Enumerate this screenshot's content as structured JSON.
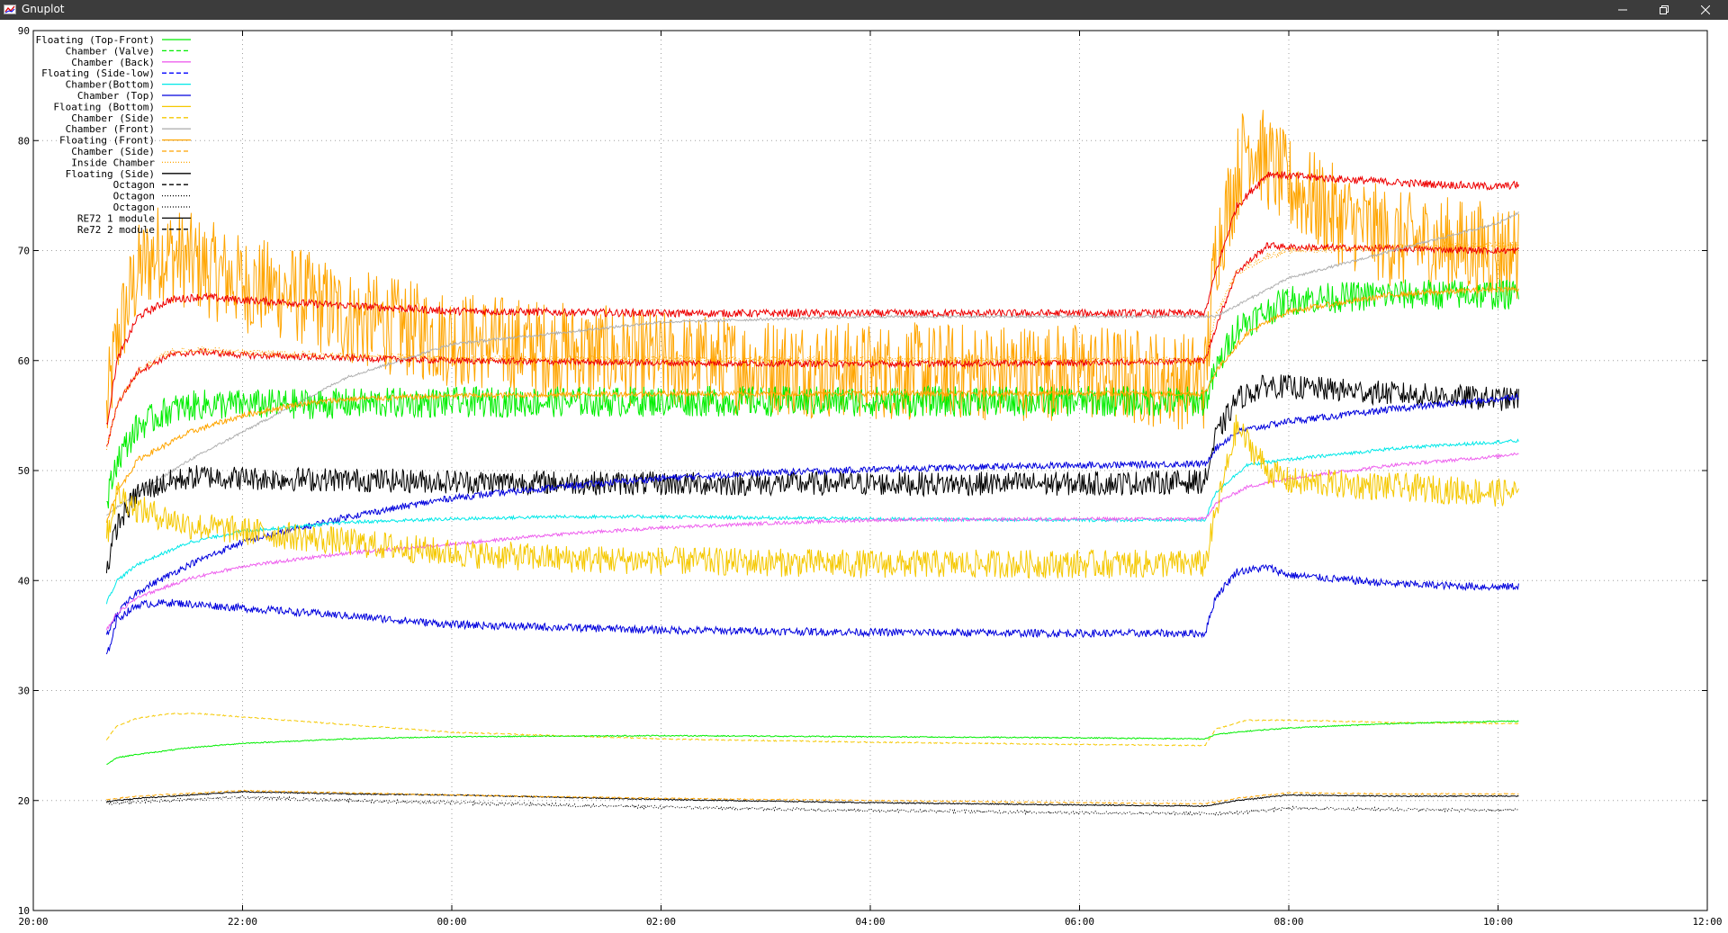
{
  "window": {
    "title": "Gnuplot",
    "icons": {
      "app": "gnuplot-app-icon",
      "minimize": "minimize-icon",
      "restore": "restore-icon",
      "close": "close-icon"
    },
    "titlebar_color": "#3c3c3c"
  },
  "chart_data": {
    "type": "line",
    "title": "",
    "xlabel": "",
    "ylabel": "",
    "grid": true,
    "legend_position": "top-left",
    "xlim": [
      0,
      16
    ],
    "ylim": [
      10,
      90
    ],
    "xticks": [
      {
        "v": 0,
        "label": "20:00"
      },
      {
        "v": 2,
        "label": "22:00"
      },
      {
        "v": 4,
        "label": "00:00"
      },
      {
        "v": 6,
        "label": "02:00"
      },
      {
        "v": 8,
        "label": "04:00"
      },
      {
        "v": 10,
        "label": "06:00"
      },
      {
        "v": 12,
        "label": "08:00"
      },
      {
        "v": 14,
        "label": "10:00"
      },
      {
        "v": 16,
        "label": "12:00"
      }
    ],
    "yticks": [
      10,
      20,
      30,
      40,
      50,
      60,
      70,
      80,
      90
    ],
    "legend": [
      {
        "label": "Floating (Top-Front)",
        "color": "#00ee00",
        "dash": "solid"
      },
      {
        "label": "Chamber (Valve)",
        "color": "#00ee00",
        "dash": "dashed"
      },
      {
        "label": "Chamber (Back)",
        "color": "#ee60ee",
        "dash": "solid"
      },
      {
        "label": "Floating (Side-low)",
        "color": "#0000ff",
        "dash": "dashed"
      },
      {
        "label": "Chamber(Bottom)",
        "color": "#00e8e8",
        "dash": "solid"
      },
      {
        "label": "Chamber (Top)",
        "color": "#0000dd",
        "dash": "solid"
      },
      {
        "label": "Floating (Bottom)",
        "color": "#f5c800",
        "dash": "solid"
      },
      {
        "label": "Chamber (Side)",
        "color": "#f5c800",
        "dash": "dashed"
      },
      {
        "label": "Chamber (Front)",
        "color": "#b0b0b0",
        "dash": "solid"
      },
      {
        "label": "Floating (Front)",
        "color": "#ffa500",
        "dash": "solid"
      },
      {
        "label": "Chamber (Side)",
        "color": "#ffa500",
        "dash": "dashed"
      },
      {
        "label": "Inside Chamber",
        "color": "#ffa500",
        "dash": "dotted"
      },
      {
        "label": "Floating (Side)",
        "color": "#000000",
        "dash": "solid"
      },
      {
        "label": "Octagon",
        "color": "#000000",
        "dash": "dashed"
      },
      {
        "label": "Octagon",
        "color": "#000000",
        "dash": "dotted"
      },
      {
        "label": "Octagon",
        "color": "#000000",
        "dash": "dotted"
      },
      {
        "label": "RE72 1 module",
        "color": "#000000",
        "dash": "solid"
      },
      {
        "label": "Re72 2 module",
        "color": "#000000",
        "dash": "dashed"
      }
    ],
    "series": [
      {
        "color": "#ffa500",
        "dash": "solid",
        "noise": 4.5,
        "x": [
          0.7,
          0.8,
          1.0,
          1.2,
          1.5,
          2.0,
          2.5,
          3.0,
          4.0,
          5.0,
          6.0,
          8.0,
          10.0,
          11.2,
          11.3,
          11.6,
          11.8,
          12.0,
          12.5,
          13.0,
          14.0,
          14.2
        ],
        "y": [
          55,
          62,
          68,
          70,
          69,
          67,
          66,
          64,
          62,
          61,
          60,
          59,
          59,
          58,
          70,
          80,
          78,
          76,
          73,
          71,
          70,
          70
        ]
      },
      {
        "color": "#ee0000",
        "dash": "solid",
        "noise": 0.35,
        "x": [
          0.7,
          0.8,
          1.0,
          1.3,
          1.6,
          2.0,
          3.0,
          4.0,
          6.0,
          8.0,
          10.0,
          11.2,
          11.3,
          11.5,
          11.8,
          12.0,
          13.0,
          14.0,
          14.2
        ],
        "y": [
          54,
          60,
          64,
          65.5,
          65.8,
          65.5,
          65,
          64.5,
          64.3,
          64.3,
          64.3,
          64.3,
          68,
          74,
          77,
          76.8,
          76.2,
          75.8,
          76
        ]
      },
      {
        "color": "#ee0000",
        "dash": "solid",
        "noise": 0.3,
        "x": [
          0.7,
          0.8,
          1.0,
          1.3,
          1.6,
          2.0,
          4.0,
          6.0,
          8.0,
          10.0,
          11.2,
          11.3,
          11.5,
          11.8,
          12.0,
          13.0,
          14.0,
          14.2
        ],
        "y": [
          52,
          56,
          59,
          60.5,
          60.8,
          60.5,
          60,
          59.8,
          59.7,
          59.8,
          60,
          63,
          68,
          70.5,
          70.3,
          70.2,
          70,
          70
        ]
      },
      {
        "color": "#ffa500",
        "dash": "dotted",
        "noise": 0.3,
        "x": [
          0.7,
          0.8,
          1.0,
          1.3,
          1.6,
          2.0,
          4.0,
          11.2,
          11.3,
          11.5,
          11.8,
          12.0,
          13.0,
          14.0,
          14.2
        ],
        "y": [
          52,
          56,
          59,
          60.8,
          61,
          60.7,
          60.2,
          60,
          64,
          68,
          69.5,
          70,
          70.3,
          70.5,
          70.5
        ]
      },
      {
        "color": "#b0b0b0",
        "dash": "solid",
        "noise": 0.12,
        "x": [
          0.7,
          1.0,
          1.5,
          2.0,
          2.5,
          3.0,
          4.0,
          6.0,
          8.0,
          10.0,
          11.2,
          11.3,
          11.6,
          12.0,
          13.0,
          14.0,
          14.2
        ],
        "y": [
          46,
          48,
          51,
          53.5,
          56,
          58.5,
          61.5,
          63.5,
          64,
          64,
          64,
          64,
          65.5,
          67.5,
          70,
          72.5,
          73.5
        ]
      },
      {
        "color": "#00ee00",
        "dash": "solid",
        "noise": 1.4,
        "x": [
          0.7,
          0.8,
          1.0,
          1.3,
          1.6,
          2.0,
          4.0,
          6.0,
          8.0,
          10.0,
          11.2,
          11.3,
          11.5,
          12.0,
          13.0,
          14.0,
          14.2
        ],
        "y": [
          47,
          51,
          54,
          55.5,
          56,
          56,
          56.2,
          56.3,
          56.3,
          56.3,
          56.3,
          59,
          63,
          65.5,
          66,
          66,
          66
        ]
      },
      {
        "color": "#ffa500",
        "dash": "solid",
        "noise": 0.25,
        "x": [
          0.7,
          0.8,
          1.0,
          1.5,
          2.0,
          2.5,
          3.0,
          4.0,
          6.0,
          8.0,
          10.0,
          11.2,
          11.3,
          11.6,
          12.0,
          13.0,
          14.0,
          14.2
        ],
        "y": [
          45.5,
          48,
          51,
          53.5,
          55,
          56,
          56.5,
          56.8,
          57,
          57,
          57,
          57,
          59,
          62.5,
          64.5,
          66,
          66.5,
          66.5
        ]
      },
      {
        "color": "#000000",
        "dash": "solid",
        "noise": 1.1,
        "x": [
          0.7,
          0.8,
          1.0,
          1.3,
          1.6,
          2.0,
          4.0,
          6.0,
          8.0,
          10.0,
          11.2,
          11.3,
          11.5,
          11.8,
          12.0,
          13.0,
          14.0,
          14.2
        ],
        "y": [
          41,
          45,
          48,
          49,
          49.5,
          49.3,
          49,
          48.8,
          48.8,
          48.8,
          49,
          53,
          56.5,
          57.8,
          57.6,
          57,
          56.5,
          56.5
        ]
      },
      {
        "color": "#0000dd",
        "dash": "solid",
        "noise": 0.3,
        "x": [
          0.7,
          0.8,
          1.0,
          1.5,
          2.0,
          3.0,
          4.0,
          5.0,
          6.0,
          7.0,
          8.0,
          9.0,
          10.0,
          11.2,
          11.3,
          11.5,
          12.0,
          12.5,
          13.0,
          14.0,
          14.2
        ],
        "y": [
          35,
          37,
          39,
          41.5,
          43.5,
          45.8,
          47.5,
          48.5,
          49.3,
          49.8,
          50.1,
          50.3,
          50.5,
          50.6,
          52,
          53.5,
          54.5,
          55,
          55.6,
          56.5,
          56.8
        ]
      },
      {
        "color": "#00e8e8",
        "dash": "solid",
        "noise": 0.15,
        "x": [
          0.7,
          0.8,
          1.0,
          1.5,
          2.0,
          3.0,
          4.0,
          5.0,
          6.0,
          8.0,
          10.0,
          11.2,
          11.3,
          11.6,
          12.0,
          13.0,
          14.0,
          14.2
        ],
        "y": [
          38,
          40,
          41.5,
          43.5,
          44.5,
          45.3,
          45.6,
          45.8,
          45.8,
          45.6,
          45.5,
          45.5,
          48,
          50.5,
          51,
          52,
          52.6,
          52.7
        ]
      },
      {
        "color": "#ee60ee",
        "dash": "solid",
        "noise": 0.15,
        "x": [
          0.7,
          0.8,
          1.0,
          1.5,
          2.0,
          3.0,
          4.0,
          5.0,
          6.0,
          7.0,
          8.0,
          10.0,
          11.2,
          11.3,
          11.6,
          12.0,
          13.0,
          14.0,
          14.2
        ],
        "y": [
          35.5,
          37,
          38.5,
          40.2,
          41.3,
          42.5,
          43.3,
          44.2,
          44.8,
          45.2,
          45.5,
          45.6,
          45.6,
          47,
          48.5,
          49.3,
          50.5,
          51.3,
          51.6
        ]
      },
      {
        "color": "#f5c800",
        "dash": "solid",
        "noise": 1.3,
        "x": [
          0.7,
          0.8,
          1.0,
          1.5,
          2.0,
          3.0,
          4.0,
          5.0,
          6.0,
          8.0,
          10.0,
          11.2,
          11.3,
          11.5,
          11.8,
          12.0,
          13.0,
          14.0,
          14.2
        ],
        "y": [
          44,
          48,
          46.5,
          45,
          44.5,
          43.5,
          42.5,
          42,
          41.8,
          41.5,
          41.5,
          41.5,
          46,
          54,
          50,
          49,
          48.5,
          48,
          48
        ]
      },
      {
        "color": "#0000dd",
        "dash": "solid",
        "noise": 0.35,
        "x": [
          0.7,
          0.8,
          1.0,
          1.3,
          2.0,
          3.0,
          4.0,
          6.0,
          8.0,
          10.0,
          11.2,
          11.3,
          11.5,
          11.8,
          12.0,
          13.0,
          14.0,
          14.2
        ],
        "y": [
          33,
          36.5,
          37.8,
          38,
          37.5,
          36.8,
          36,
          35.5,
          35.3,
          35.2,
          35.2,
          38.5,
          40.8,
          41.2,
          40.5,
          39.7,
          39.4,
          39.5
        ]
      },
      {
        "color": "#f5c800",
        "dash": "dashed",
        "noise": 0.05,
        "x": [
          0.7,
          0.8,
          1.0,
          1.3,
          1.6,
          2.0,
          3.0,
          4.0,
          6.0,
          8.0,
          10.0,
          11.2,
          11.3,
          11.6,
          12.0,
          13.0,
          14.0,
          14.2
        ],
        "y": [
          25.5,
          26.8,
          27.5,
          27.9,
          27.9,
          27.6,
          26.9,
          26.2,
          25.6,
          25.3,
          25.1,
          25,
          26.5,
          27.3,
          27.3,
          27.1,
          27,
          27
        ]
      },
      {
        "color": "#00ee00",
        "dash": "solid",
        "noise": 0.05,
        "x": [
          0.7,
          0.8,
          1.0,
          1.5,
          2.0,
          3.0,
          4.0,
          6.0,
          8.0,
          10.0,
          11.2,
          11.3,
          11.6,
          12.0,
          13.0,
          14.0,
          14.2
        ],
        "y": [
          23.3,
          23.9,
          24.2,
          24.8,
          25.2,
          25.6,
          25.8,
          25.9,
          25.8,
          25.7,
          25.6,
          26,
          26.3,
          26.6,
          27,
          27.2,
          27.2
        ]
      },
      {
        "color": "#000000",
        "dash": "solid",
        "noise": 0.05,
        "x": [
          0.7,
          1.0,
          2.0,
          3.0,
          4.0,
          6.0,
          8.0,
          10.0,
          11.2,
          11.5,
          12.0,
          13.0,
          14.0,
          14.2
        ],
        "y": [
          19.9,
          20.2,
          20.8,
          20.6,
          20.5,
          20.1,
          19.8,
          19.6,
          19.5,
          20,
          20.5,
          20.4,
          20.4,
          20.4
        ]
      },
      {
        "color": "#ffa500",
        "dash": "dashed",
        "noise": 0.05,
        "x": [
          0.7,
          1.0,
          2.0,
          3.0,
          4.0,
          6.0,
          8.0,
          10.0,
          11.2,
          11.5,
          12.0,
          13.0,
          14.0,
          14.2
        ],
        "y": [
          20.1,
          20.4,
          20.9,
          20.7,
          20.5,
          20.2,
          20,
          19.8,
          19.7,
          20.2,
          20.7,
          20.6,
          20.6,
          20.6
        ]
      },
      {
        "color": "#000000",
        "dash": "dotted",
        "noise": 0.15,
        "x": [
          0.7,
          1.0,
          2.0,
          3.0,
          4.0,
          6.0,
          8.0,
          10.0,
          11.2,
          11.5,
          12.0,
          13.0,
          14.0,
          14.2
        ],
        "y": [
          19.7,
          19.9,
          20.3,
          20,
          19.8,
          19.4,
          19.1,
          18.9,
          18.8,
          18.9,
          19.3,
          19.2,
          19.1,
          19.2
        ]
      }
    ]
  }
}
